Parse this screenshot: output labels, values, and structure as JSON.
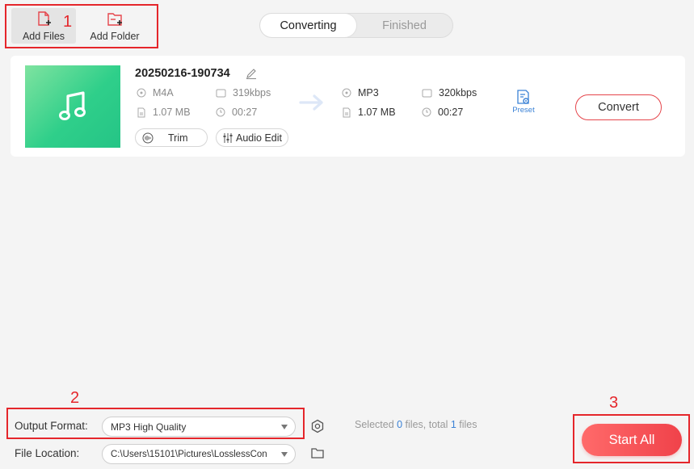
{
  "toolbar": {
    "add_files": "Add Files",
    "add_folder": "Add Folder"
  },
  "tabs": [
    {
      "label": "Converting",
      "active": true
    },
    {
      "label": "Finished",
      "active": false
    }
  ],
  "annotations": {
    "one": "1",
    "two": "2",
    "three": "3"
  },
  "file": {
    "name": "20250216-190734",
    "source": {
      "format": "M4A",
      "bitrate": "319kbps",
      "size": "1.07 MB",
      "duration": "00:27"
    },
    "target": {
      "format": "MP3",
      "bitrate": "320kbps",
      "size": "1.07 MB",
      "duration": "00:27"
    },
    "trim_label": "Trim",
    "audio_edit_label": "Audio Edit",
    "preset_label": "Preset",
    "convert_label": "Convert"
  },
  "bottom": {
    "output_format_label": "Output Format:",
    "output_format_value": "MP3 High Quality",
    "file_location_label": "File Location:",
    "file_location_value": "C:\\Users\\15101\\Pictures\\LosslessCon",
    "status_selected_prefix": "Selected ",
    "selected_count": "0",
    "status_middle": " files, total ",
    "total_count": "1",
    "status_suffix": " files",
    "start_all_label": "Start All"
  },
  "colors": {
    "accent_red": "#e5262b",
    "start_gradient_from": "#ff6a6a",
    "start_gradient_to": "#f0424a",
    "link_blue": "#3b82d6",
    "thumb_green": "#2fcf8a"
  }
}
